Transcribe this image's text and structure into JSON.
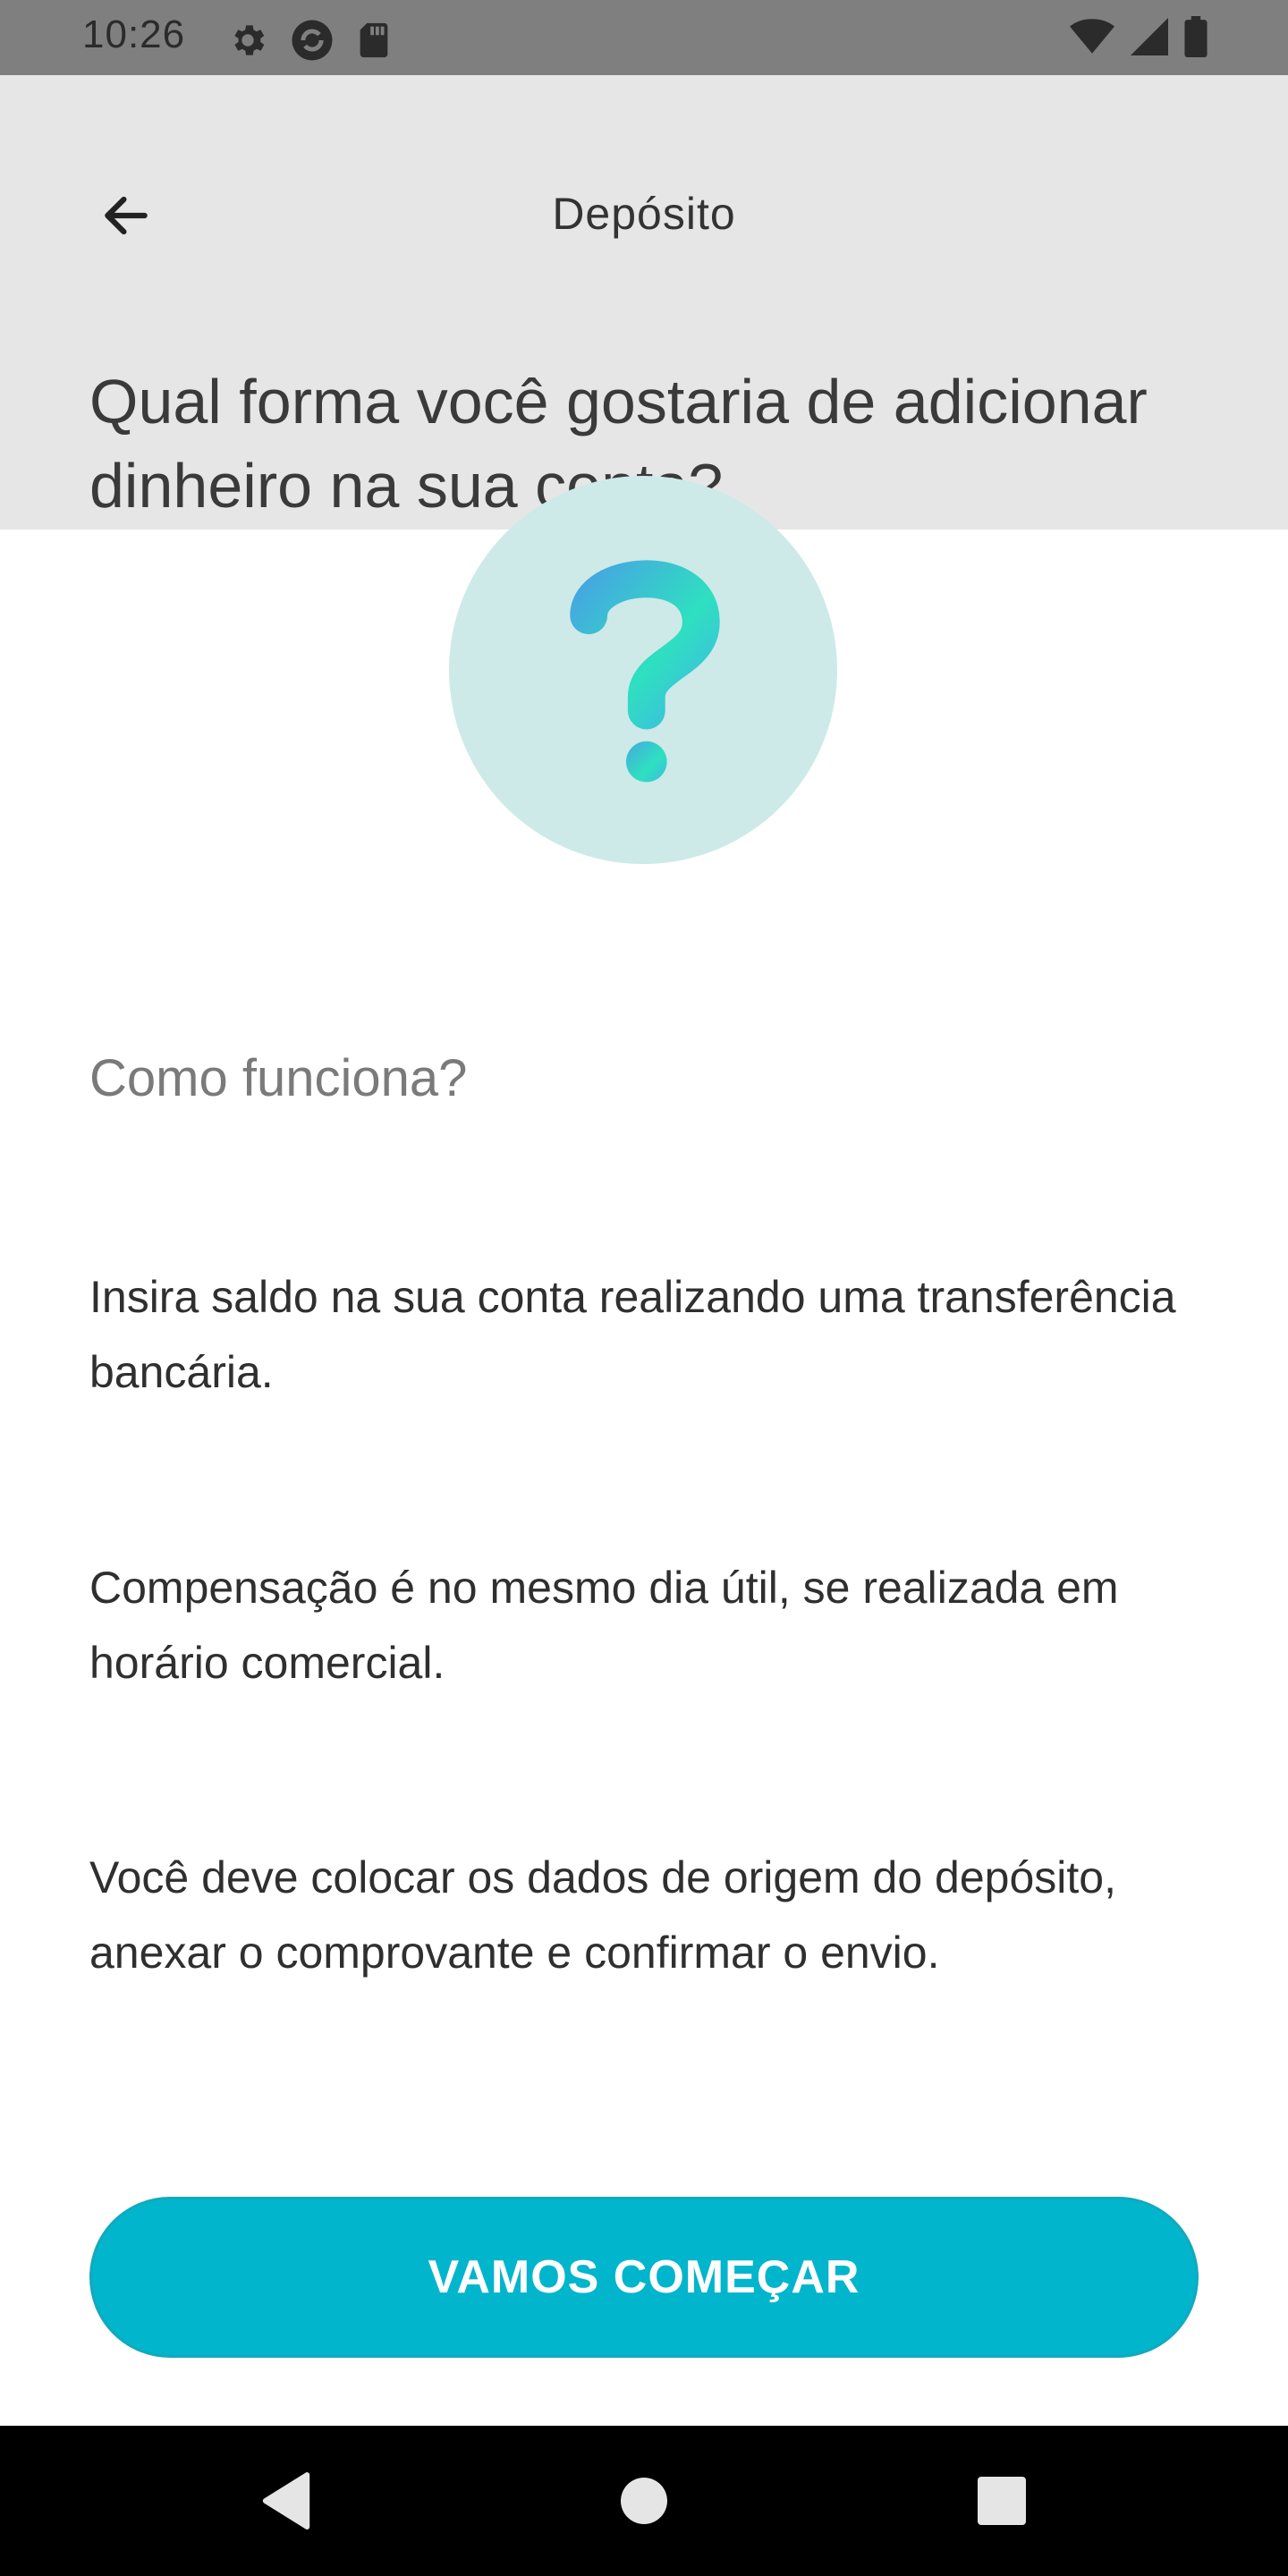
{
  "status_bar": {
    "time": "10:26",
    "icons_left": [
      "gear-icon",
      "sync-icon",
      "sd-card-icon"
    ],
    "icons_right": [
      "wifi-icon",
      "signal-icon",
      "battery-icon"
    ]
  },
  "header": {
    "back_icon": "arrow-left-icon",
    "title": "Depósito",
    "question": "Qual forma você gostaria de adicionar dinheiro na sua conta?"
  },
  "illustration": {
    "icon": "question-mark-icon",
    "circle_color": "#cdeae8"
  },
  "content": {
    "section_title": "Como funciona?",
    "paragraphs": [
      "Insira saldo na sua conta realizando uma transferência bancária.",
      "Compensação é no mesmo dia útil, se realizada em horário comercial.",
      "Você deve colocar os dados de origem do depósito, anexar o comprovante e confirmar o envio."
    ]
  },
  "cta": {
    "label": "VAMOS COMEÇAR",
    "color": "#00b5cc"
  },
  "nav_bar": {
    "back_icon": "nav-back-icon",
    "home_icon": "nav-home-icon",
    "recents_icon": "nav-recents-icon"
  }
}
